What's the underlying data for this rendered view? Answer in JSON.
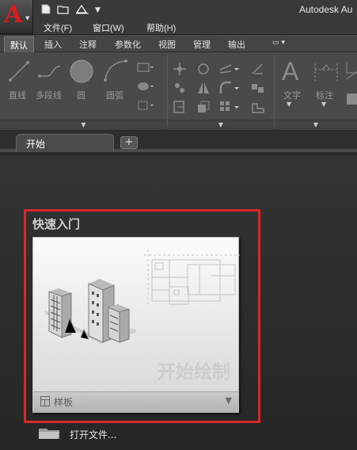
{
  "window": {
    "title": "Autodesk Au"
  },
  "app_button": {
    "letter": "A"
  },
  "menu": [
    {
      "label": "文件(F)"
    },
    {
      "label": "窗口(W)"
    },
    {
      "label": "帮助(H)"
    }
  ],
  "ribbon_tabs": [
    "默认",
    "插入",
    "注释",
    "参数化",
    "视图",
    "管理",
    "输出"
  ],
  "draw_panel": {
    "line": "直线",
    "polyline": "多段线",
    "circle": "圆",
    "arc": "圆弧"
  },
  "annotation_panel": {
    "text": "文字",
    "dimension": "标注"
  },
  "file_tabs": {
    "start": "开始",
    "plus": "+"
  },
  "quick_start": {
    "heading": "快速入门",
    "card_title": "开始绘制",
    "template_label": "样板",
    "template_arrow": "▼"
  },
  "open_file": {
    "label": "打开文件..."
  },
  "colors": {
    "app_red": "#d6201f",
    "highlight_red": "#d9262a"
  }
}
